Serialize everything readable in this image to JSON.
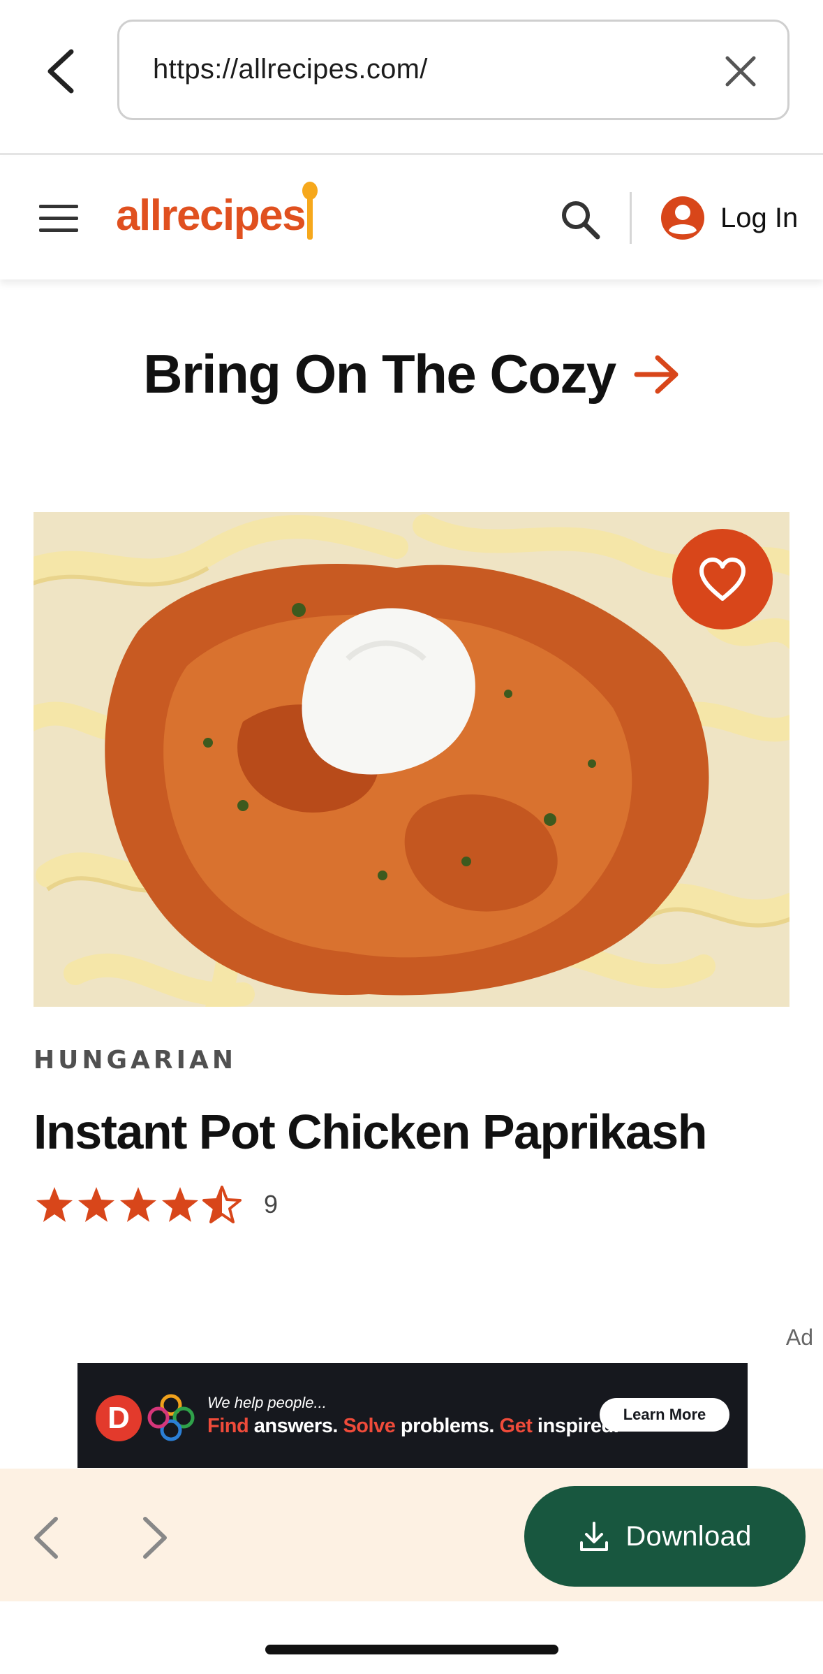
{
  "browser": {
    "url": "https://allrecipes.com/"
  },
  "header": {
    "logo_text": "allrecipes",
    "login_label": "Log In"
  },
  "section": {
    "title": "Bring On The Cozy"
  },
  "recipe": {
    "category": "HUNGARIAN",
    "title": "Instant Pot Chicken Paprikash",
    "rating_stars": 4.5,
    "rating_count": "9"
  },
  "ad": {
    "label": "Ad",
    "badge_letter": "D",
    "tagline_small": "We help people...",
    "tagline_parts": [
      "Find",
      " answers. ",
      "Solve",
      " problems. ",
      "Get",
      " inspired."
    ],
    "cta": "Learn More"
  },
  "toolbar": {
    "download_label": "Download"
  },
  "colors": {
    "brand_orange": "#e0501f",
    "save_button": "#d8461a",
    "download_green": "#18573f",
    "toolbar_background": "#fdf1e3",
    "star": "#d8461a"
  },
  "icons": {
    "back": "chevron-left-icon",
    "clear": "close-icon",
    "menu": "hamburger-icon",
    "search": "search-icon",
    "account": "user-circle-icon",
    "arrow": "arrow-right-icon",
    "save": "heart-icon",
    "download": "download-icon"
  }
}
